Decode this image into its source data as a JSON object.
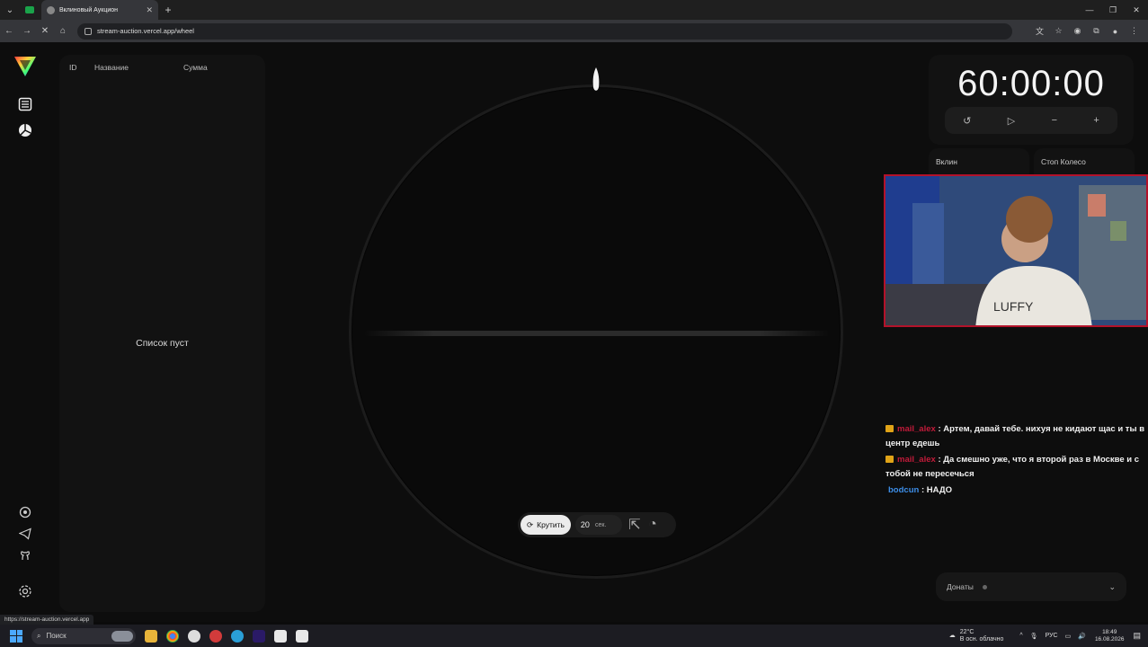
{
  "browser": {
    "tab_title": "Вклиновый Аукцион",
    "url": "stream-auction.vercel.app/wheel",
    "status_url": "https://stream-auction.vercel.app"
  },
  "list": {
    "col_id": "ID",
    "col_name": "Название",
    "col_sum": "Сумма",
    "empty_text": "Список пуст"
  },
  "wheel_controls": {
    "spin_label": "Крутить",
    "seconds_value": "20",
    "seconds_unit": "сек."
  },
  "timer": {
    "h": "60",
    "m": "00",
    "s": "00",
    "sep": ":"
  },
  "stats": {
    "vklin_label": "Вклин",
    "stop_label": "Стоп Колесо"
  },
  "chat": [
    {
      "user": "mail_alex",
      "text": ": Артем, давай тебе. нихуя не кидают щас и ты в центр едешь"
    },
    {
      "user": "mail_alex",
      "text": ": Да смешно уже, что я второй раз в Москве и с тобой не пересечься"
    },
    {
      "user": "bodcun",
      "text": ": НАДО"
    }
  ],
  "donats": {
    "label": "Донаты"
  },
  "taskbar": {
    "search": "Поиск",
    "temp": "22°C",
    "weather": "В осн. облачно",
    "lang": "РУС",
    "time": "18:49",
    "date": "16.08.2026"
  },
  "colors": {
    "accent_red": "#b3122a",
    "chat_user_red": "#c21b3a",
    "chat_user_blue": "#3d8ee8"
  }
}
